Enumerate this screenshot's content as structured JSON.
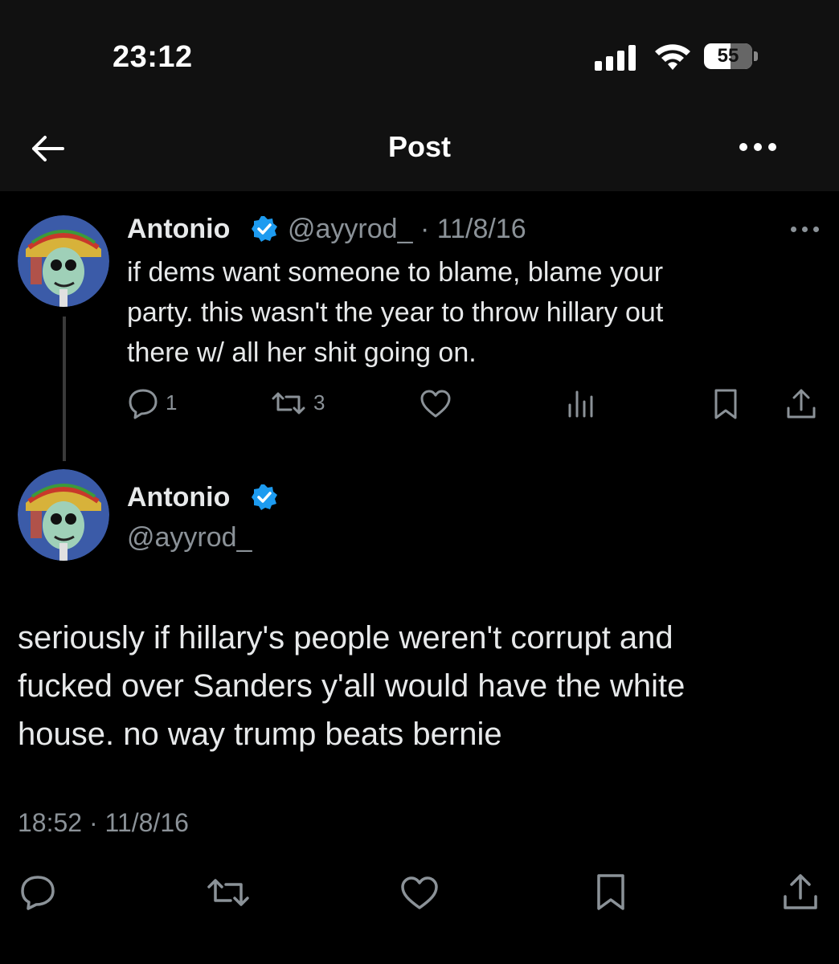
{
  "status_bar": {
    "time": "23:12",
    "battery": "55",
    "battery_level_percent": 55,
    "icons": [
      "signal-icon",
      "wifi-icon",
      "battery-icon"
    ]
  },
  "nav": {
    "title": "Post",
    "back_icon": "back-arrow-icon",
    "more_icon": "more-icon"
  },
  "parent_post": {
    "name": "Antonio",
    "handle": "@ayyrod_",
    "date": "· 11/8/16",
    "text_lines": [
      "if dems want someone to blame, blame your",
      "party. this wasn't the year to throw hillary out",
      "there w/ all her shit going on."
    ],
    "replies": "1",
    "reposts": "3"
  },
  "main_post": {
    "name": "Antonio",
    "handle": "@ayyrod_",
    "text_lines": [
      "seriously if hillary's people weren't corrupt and",
      "fucked over Sanders y'all would have the white",
      "house. no way trump beats bernie"
    ],
    "timestamp": "18:52 · 11/8/16"
  },
  "colors": {
    "background": "#000000",
    "topbar": "#111111",
    "text": "#e7e9ea",
    "muted": "#8b9298",
    "verified": "#1d9bf0"
  }
}
